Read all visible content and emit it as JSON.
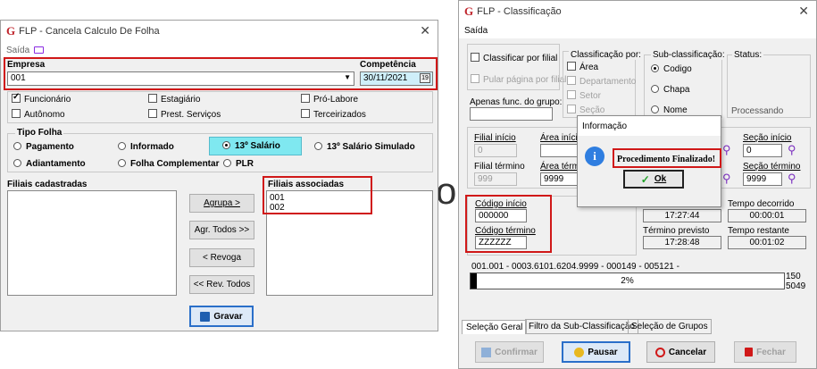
{
  "bg_text": "ol",
  "left": {
    "title": "FLP - Cancela Calculo De Folha",
    "menu_saida": "Saída",
    "empresa_label": "Empresa",
    "empresa_value": "001",
    "competencia_label": "Competência",
    "competencia_value": "30/11/2021",
    "checks": {
      "funcionario": "Funcionário",
      "estagiario": "Estagiário",
      "pro_labore": "Pró-Labore",
      "autonomo": "Autônomo",
      "prest_servicos": "Prest. Serviços",
      "terceirizados": "Terceirizados"
    },
    "tipo_folha": {
      "legend": "Tipo Folha",
      "pagamento": "Pagamento",
      "informado": "Informado",
      "decimo_terceiro": "13º Salário",
      "decimo_simulado": "13º Salário Simulado",
      "adiantamento": "Adiantamento",
      "folha_complementar": "Folha Complementar",
      "plr": "PLR"
    },
    "filiais_cadastradas": "Filiais cadastradas",
    "filiais_associadas": "Filiais associadas",
    "associadas_items": [
      "001",
      "002"
    ],
    "buttons": {
      "agrupa": "Agrupa >",
      "agr_todos": "Agr. Todos >>",
      "revoga": "< Revoga",
      "rev_todos": "<< Rev. Todos",
      "gravar": "Gravar"
    }
  },
  "right": {
    "title": "FLP - Classificação",
    "menu_saida": "Saída",
    "classificar_por_filial": "Classificar por filial",
    "pular_pagina": "Pular página por filial",
    "classificacao_por": "Classificação por:",
    "class_items": [
      "Área",
      "Departamento",
      "Setor",
      "Seção"
    ],
    "sub_classificacao": "Sub-classificação:",
    "sub_items": [
      "Codigo",
      "Chapa",
      "Nome"
    ],
    "status_label": "Status:",
    "status_value": "Processando",
    "apenas_func": "Apenas func. do grupo:",
    "filial_inicio": "Filial início",
    "filial_inicio_value": "0",
    "filial_termino": "Filial término",
    "filial_termino_value": "999",
    "area_inicio": "Área início",
    "area_termino": "Área término",
    "area_termino_value": "9999",
    "secao_inicio": "Seção início",
    "secao_inicio_value": "0",
    "secao_termino": "Seção término",
    "secao_termino_value": "9999",
    "codigo_inicio": "Código início",
    "codigo_inicio_value": "000000",
    "codigo_termino": "Código término",
    "codigo_termino_value": "ZZZZZZ",
    "hora_inicio_value": "17:27:44",
    "tempo_decorrido": "Tempo decorrido",
    "tempo_decorrido_value": "00:00:01",
    "termino_previsto": "Término previsto",
    "termino_previsto_value": "17:28:48",
    "tempo_restante": "Tempo restante",
    "tempo_restante_value": "00:01:02",
    "progress_caption": "001.001 - 0003.6101.6204.9999 - 000149 - 005121 -",
    "progress_percent": 2,
    "progress_text": "2%",
    "progress_count_top": "150",
    "progress_count_bottom": "5049",
    "tabs": [
      "Seleção Geral",
      "Filtro da Sub-Classificação",
      "Seleção de Grupos"
    ],
    "buttons": {
      "confirmar": "Confirmar",
      "pausar": "Pausar",
      "cancelar": "Cancelar",
      "fechar": "Fechar"
    }
  },
  "dialog": {
    "title": "Informação",
    "message": "Procedimento Finalizado!",
    "ok": "Ok"
  }
}
